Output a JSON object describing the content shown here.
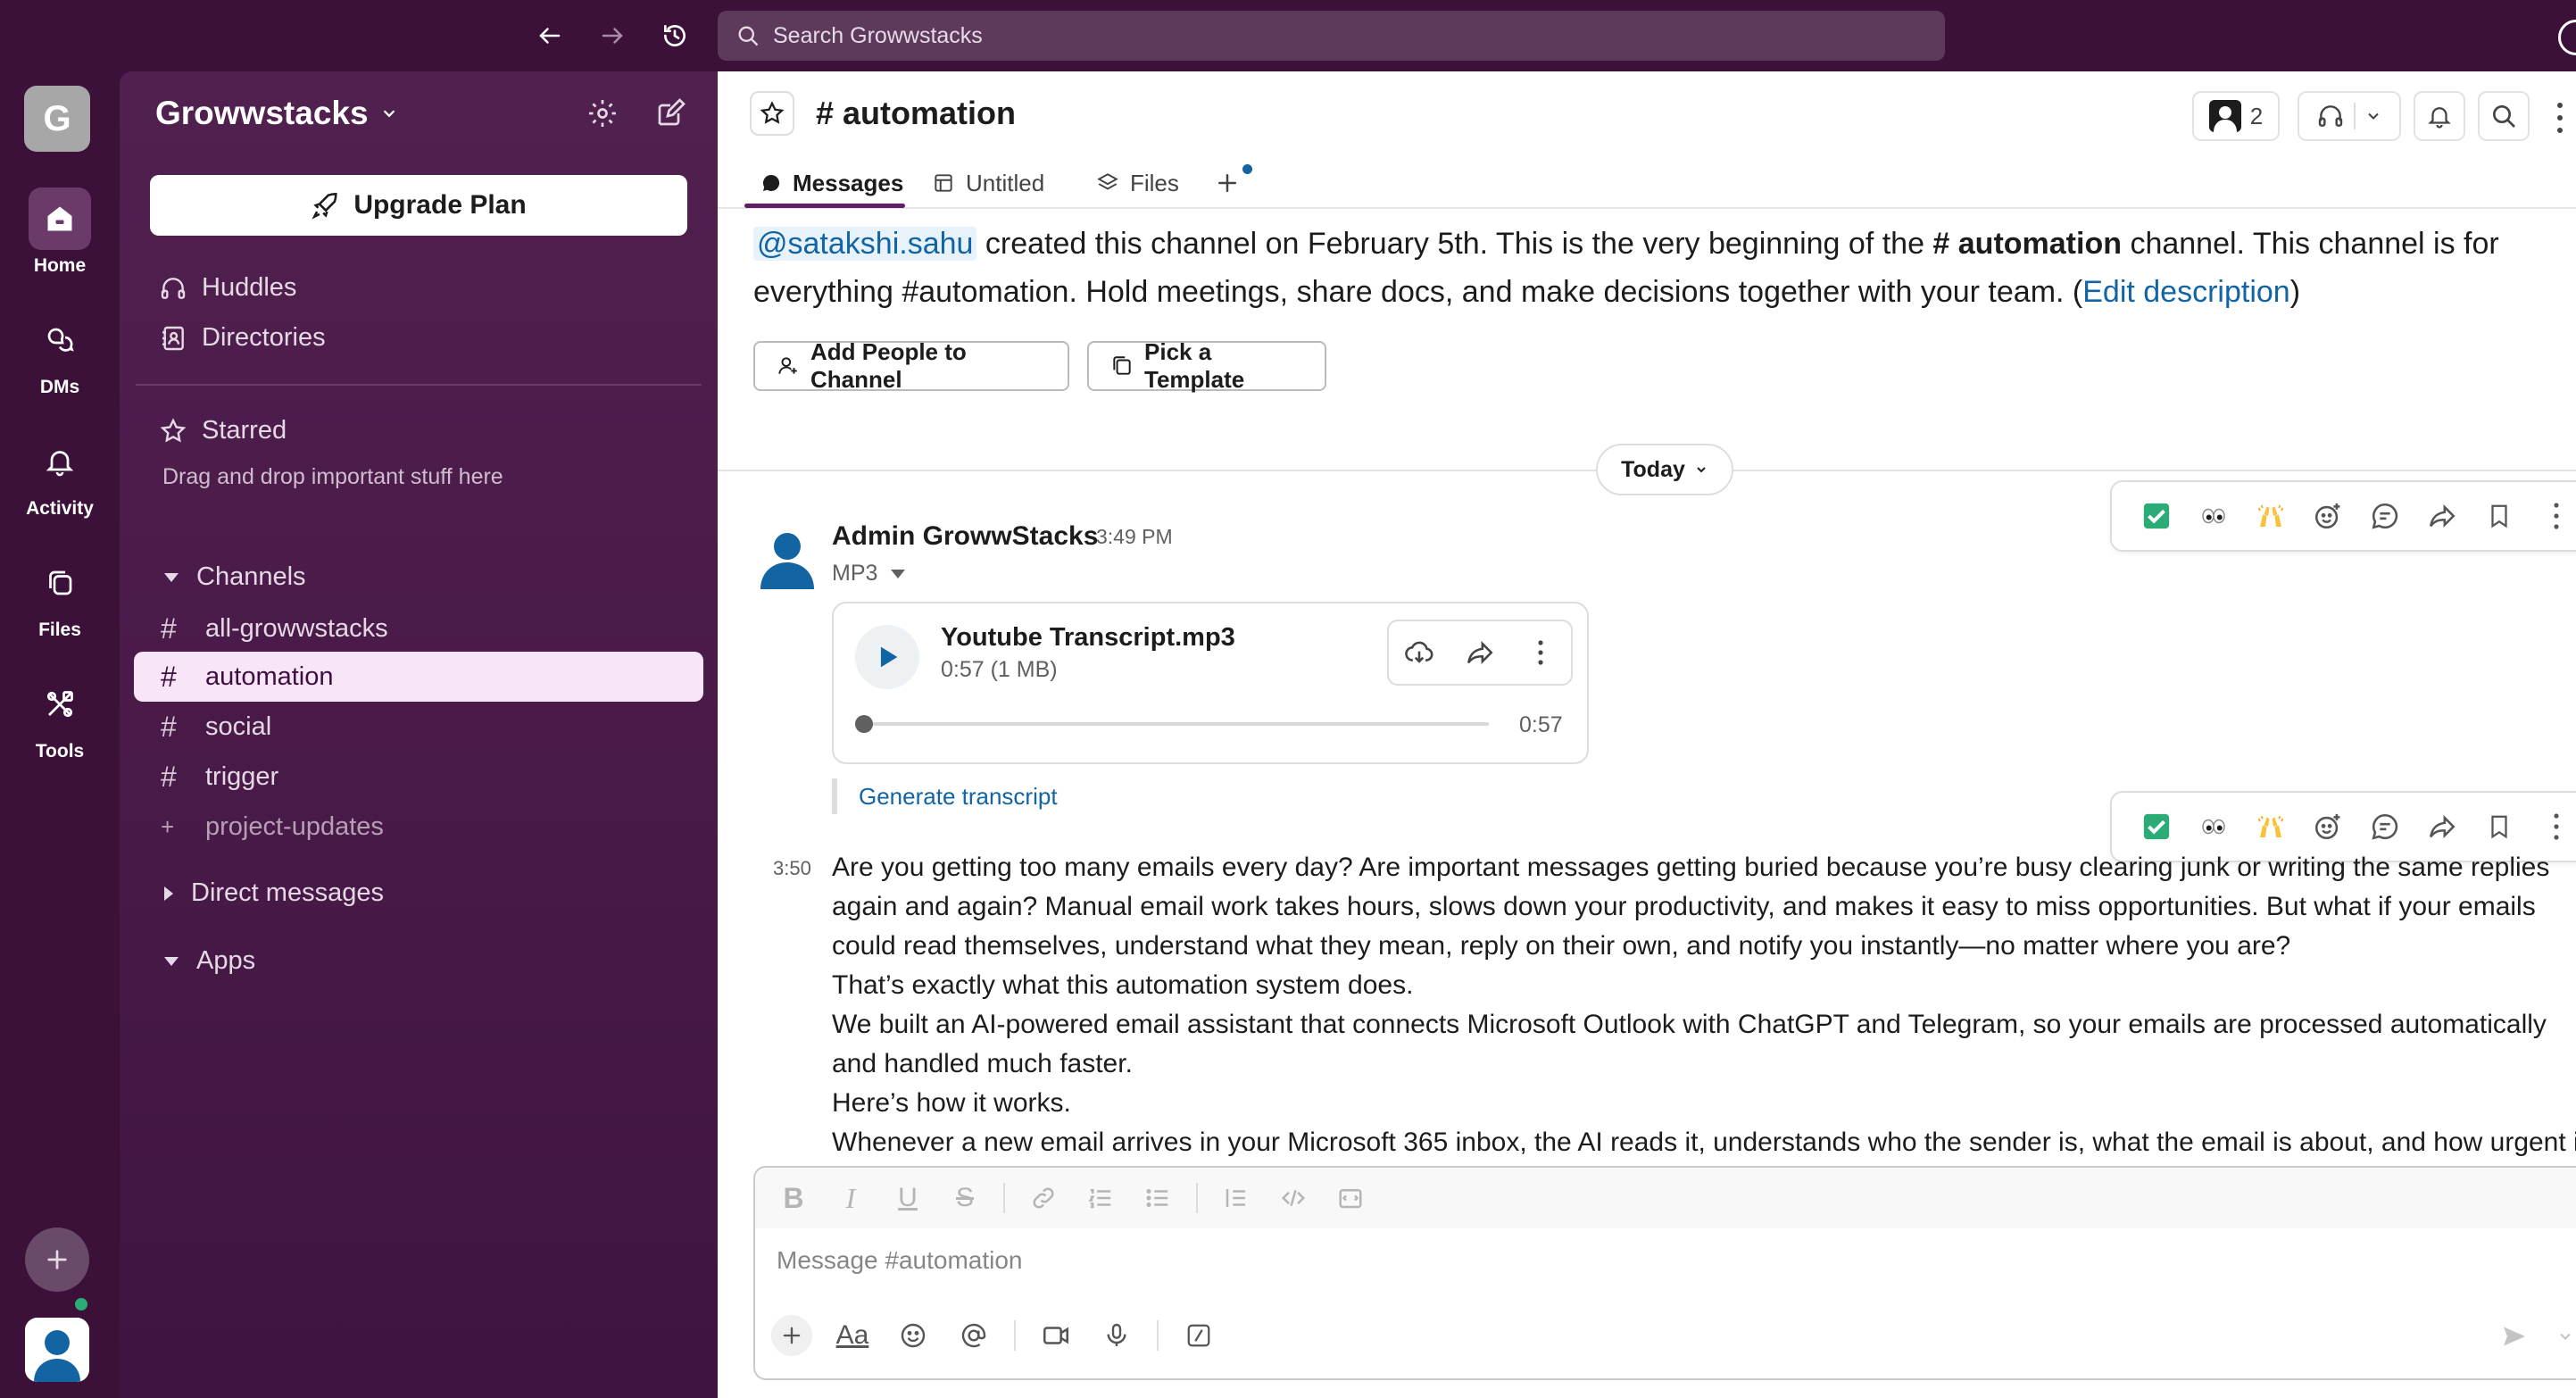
{
  "topbar": {
    "search_placeholder": "Search Growwstacks"
  },
  "rail": {
    "workspace_initial": "G",
    "items": [
      {
        "label": "Home",
        "icon": "home-icon"
      },
      {
        "label": "DMs",
        "icon": "dm-icon"
      },
      {
        "label": "Activity",
        "icon": "bell-icon"
      },
      {
        "label": "Files",
        "icon": "files-icon"
      },
      {
        "label": "Tools",
        "icon": "tools-icon"
      }
    ]
  },
  "sidebar": {
    "workspace_name": "Growwstacks",
    "upgrade_label": "Upgrade Plan",
    "huddles_label": "Huddles",
    "directories_label": "Directories",
    "starred_label": "Starred",
    "starred_note": "Drag and drop important stuff here",
    "channels_label": "Channels",
    "channels": [
      {
        "name": "all-growwstacks"
      },
      {
        "name": "automation",
        "active": true
      },
      {
        "name": "social"
      },
      {
        "name": "trigger"
      },
      {
        "name": "project-updates"
      }
    ],
    "direct_messages_label": "Direct messages",
    "apps_label": "Apps"
  },
  "header": {
    "channel_title": "# automation",
    "member_count": "2",
    "tabs": [
      {
        "label": "Messages",
        "active": true
      },
      {
        "label": "Untitled"
      },
      {
        "label": "Files"
      }
    ]
  },
  "intro": {
    "mention": "@satakshi.sahu",
    "text_1": " created this channel on February 5th. This is the very beginning of the ",
    "channel_ref": "# automation",
    "text_2": " channel. This channel is for everything #automation. Hold meetings, share docs, and make decisions together with your team. (",
    "edit_link": "Edit description",
    "text_3": ")",
    "add_people_label": "Add People to Channel",
    "template_label": "Pick a Template"
  },
  "divider": {
    "day_label": "Today"
  },
  "message1": {
    "author": "Admin GrowwStacks",
    "time": "3:49 PM",
    "attachment_type": "MP3",
    "file_name": "Youtube Transcript.mp3",
    "file_meta": "0:57 (1 MB)",
    "duration": "0:57",
    "progress": 0,
    "transcript_link": "Generate transcript"
  },
  "message2": {
    "time": "3:50",
    "lines": [
      "Are you getting too many emails every day? Are important messages getting buried because you’re busy clearing junk or writing the same replies again and again? Manual email work takes hours, slows down your productivity, and makes it easy to miss opportunities. But what if your emails could read themselves, understand what they mean, reply on their own, and notify you instantly—no matter where you are?",
      "That’s exactly what this automation system does.",
      "We built an AI-powered email assistant that connects Microsoft Outlook with ChatGPT and Telegram, so your emails are processed automatically and handled much faster.",
      "Here’s how it works.",
      "Whenever a new email arrives in your Microsoft 365 inbox, the AI reads it, understands who the sender is, what the email is about, and how urgent it"
    ]
  },
  "hover_bar": {
    "items": [
      "check-reaction",
      "eyes-reaction",
      "raised-hands-reaction",
      "add-reaction-icon",
      "reply-thread-icon",
      "forward-icon",
      "bookmark-icon",
      "more-icon"
    ]
  },
  "composer": {
    "placeholder": "Message #automation",
    "aa_label": "Aa"
  },
  "colors": {
    "aubergine": "#3f0e40",
    "active_channel_bg": "#f8e6f8",
    "link": "#1264a3",
    "check_green": "#2bac76"
  }
}
